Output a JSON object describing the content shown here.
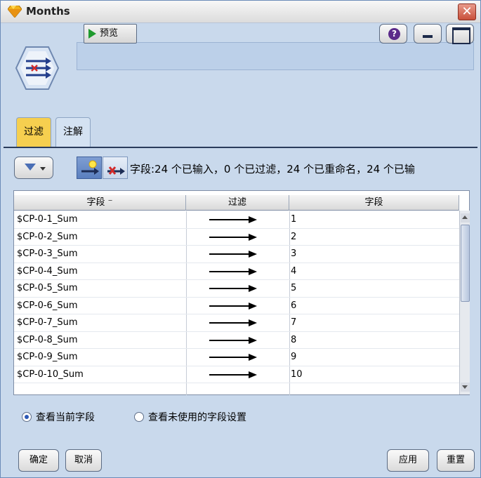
{
  "window": {
    "title": "Months",
    "close_label": "✕"
  },
  "toolbar": {
    "preview_label": "预览",
    "help_label": "?"
  },
  "tabs": [
    {
      "label": "过滤",
      "active": true
    },
    {
      "label": "注解",
      "active": false
    }
  ],
  "filter_summary": "字段:24 个已输入，0 个已过滤，24 个已重命名，24 个已输",
  "table": {
    "headers": [
      "字段 ⁻",
      "过滤",
      "字段"
    ],
    "rows": [
      {
        "field": "$CP-0-1_Sum",
        "new_name": "1"
      },
      {
        "field": "$CP-0-2_Sum",
        "new_name": "2"
      },
      {
        "field": "$CP-0-3_Sum",
        "new_name": "3"
      },
      {
        "field": "$CP-0-4_Sum",
        "new_name": "4"
      },
      {
        "field": "$CP-0-5_Sum",
        "new_name": "5"
      },
      {
        "field": "$CP-0-6_Sum",
        "new_name": "6"
      },
      {
        "field": "$CP-0-7_Sum",
        "new_name": "7"
      },
      {
        "field": "$CP-0-8_Sum",
        "new_name": "8"
      },
      {
        "field": "$CP-0-9_Sum",
        "new_name": "9"
      },
      {
        "field": "$CP-0-10_Sum",
        "new_name": "10"
      }
    ]
  },
  "view_options": {
    "current": "查看当前字段",
    "unused": "查看未使用的字段设置",
    "selected": "current"
  },
  "buttons": {
    "ok": "确定",
    "cancel": "取消",
    "apply": "应用",
    "reset": "重置"
  },
  "colors": {
    "window_bg": "#c9d9ec",
    "active_tab": "#f6cf4f",
    "close_button": "#c9503a",
    "play_green": "#1f9a2e"
  },
  "icons": {
    "title": "gem-icon",
    "node": "filter-node-icon",
    "filter": "funnel-icon",
    "preview": "play-icon"
  }
}
